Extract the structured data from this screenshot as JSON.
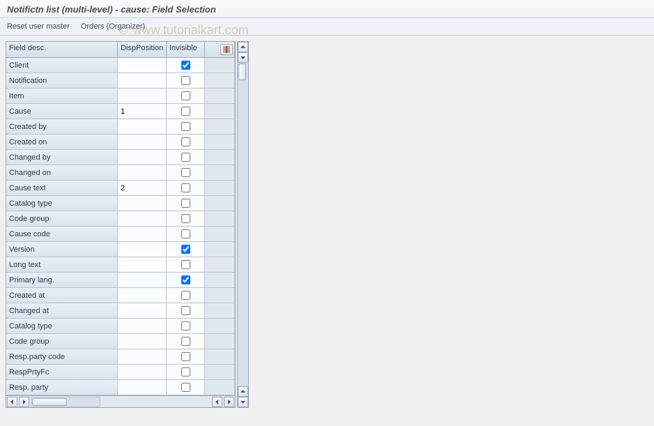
{
  "title": "Notifictn list (multi-level) - cause: Field Selection",
  "toolbar": {
    "reset_label": "Reset user master",
    "orders_label": "Orders (Organizer)"
  },
  "watermark": "www.tutorialkart.com",
  "columns": {
    "desc": "Field desc.",
    "pos": "DispPosition",
    "inv": "Invisible"
  },
  "rows": [
    {
      "desc": "Client",
      "pos": "",
      "inv": true
    },
    {
      "desc": "Notification",
      "pos": "",
      "inv": false
    },
    {
      "desc": "Item",
      "pos": "",
      "inv": false
    },
    {
      "desc": "Cause",
      "pos": "1",
      "inv": false
    },
    {
      "desc": "Created by",
      "pos": "",
      "inv": false
    },
    {
      "desc": "Created on",
      "pos": "",
      "inv": false
    },
    {
      "desc": "Changed by",
      "pos": "",
      "inv": false
    },
    {
      "desc": "Changed on",
      "pos": "",
      "inv": false
    },
    {
      "desc": "Cause text",
      "pos": "2",
      "inv": false
    },
    {
      "desc": "Catalog type",
      "pos": "",
      "inv": false
    },
    {
      "desc": "Code group",
      "pos": "",
      "inv": false
    },
    {
      "desc": "Cause code",
      "pos": "",
      "inv": false
    },
    {
      "desc": "Version",
      "pos": "",
      "inv": true
    },
    {
      "desc": "Long text",
      "pos": "",
      "inv": false
    },
    {
      "desc": "Primary lang.",
      "pos": "",
      "inv": true
    },
    {
      "desc": "Created at",
      "pos": "",
      "inv": false
    },
    {
      "desc": "Changed at",
      "pos": "",
      "inv": false
    },
    {
      "desc": "Catalog type",
      "pos": "",
      "inv": false
    },
    {
      "desc": "Code group",
      "pos": "",
      "inv": false
    },
    {
      "desc": "Resp.party code",
      "pos": "",
      "inv": false
    },
    {
      "desc": "RespPrtyFc",
      "pos": "",
      "inv": false
    },
    {
      "desc": "Resp. party",
      "pos": "",
      "inv": false
    }
  ]
}
